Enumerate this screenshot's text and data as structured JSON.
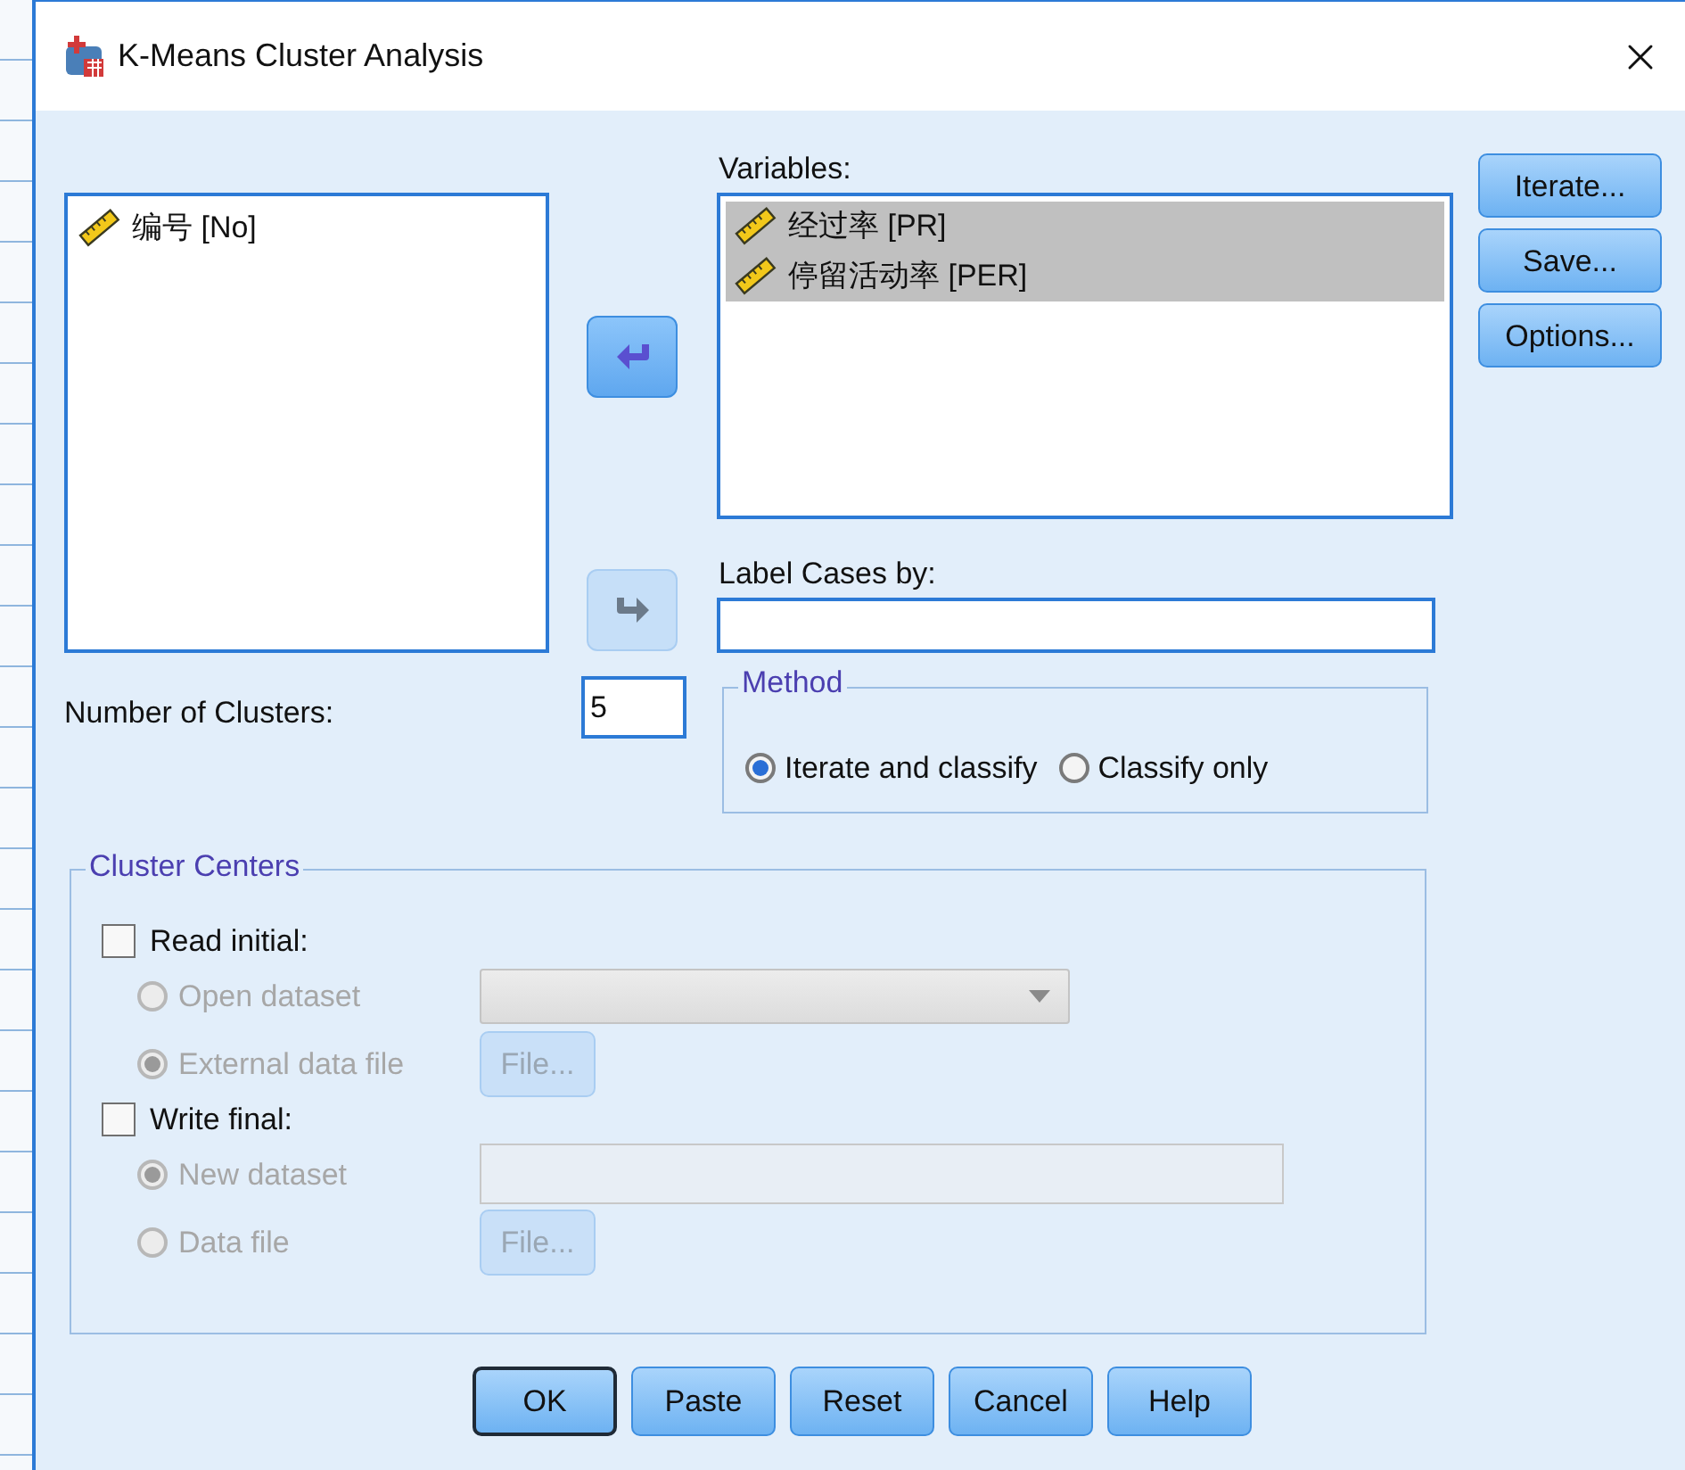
{
  "window": {
    "title": "K-Means Cluster Analysis"
  },
  "source_list": {
    "items": [
      {
        "label": "编号 [No]",
        "selected": false
      }
    ]
  },
  "move_buttons": [
    {
      "kind": "left",
      "disabled": false
    },
    {
      "kind": "right",
      "disabled": true
    }
  ],
  "variables": {
    "label": "Variables:",
    "items": [
      {
        "label": "经过率 [PR]",
        "selected": true
      },
      {
        "label": "停留活动率 [PER]",
        "selected": true
      }
    ]
  },
  "side_buttons": [
    "Iterate...",
    "Save...",
    "Options..."
  ],
  "label_cases": {
    "label": "Label Cases by:"
  },
  "number_of_clusters": {
    "label": "Number of Clusters:",
    "value": "5"
  },
  "method": {
    "title": "Method",
    "options": [
      {
        "label": "Iterate and classify",
        "selected": true
      },
      {
        "label": "Classify only",
        "selected": false
      }
    ]
  },
  "cluster_centers": {
    "title": "Cluster Centers",
    "sections": [
      {
        "label": "Read initial:",
        "checked": false,
        "options": [
          {
            "label": "Open dataset",
            "selected": false,
            "disabled": true,
            "kind": "dropdown"
          },
          {
            "label": "External data file",
            "selected": true,
            "disabled": true,
            "kind": "file",
            "button": "File..."
          }
        ]
      },
      {
        "label": "Write final:",
        "checked": false,
        "options": [
          {
            "label": "New dataset",
            "selected": true,
            "disabled": true,
            "kind": "text"
          },
          {
            "label": "Data file",
            "selected": false,
            "disabled": true,
            "kind": "file",
            "button": "File..."
          }
        ]
      }
    ]
  },
  "buttons": [
    {
      "label": "OK",
      "default": true
    },
    {
      "label": "Paste",
      "default": false
    },
    {
      "label": "Reset",
      "default": false
    },
    {
      "label": "Cancel",
      "default": false
    },
    {
      "label": "Help",
      "default": false
    }
  ]
}
